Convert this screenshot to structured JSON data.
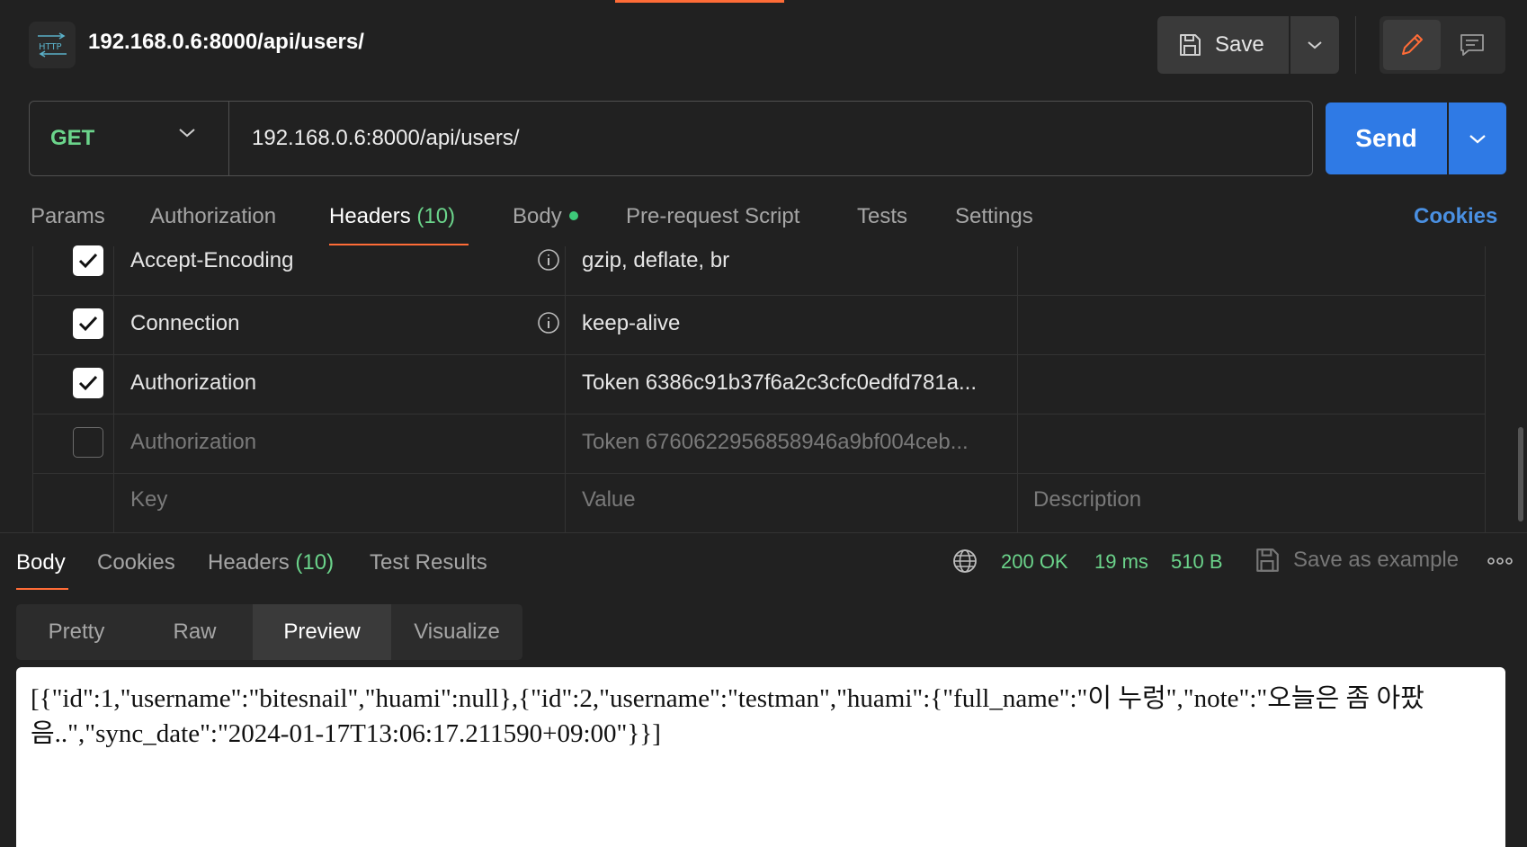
{
  "header": {
    "protocol_badge": "HTTP",
    "title": "192.168.0.6:8000/api/users/",
    "save_label": "Save"
  },
  "request": {
    "method": "GET",
    "url": "192.168.0.6:8000/api/users/",
    "send_label": "Send"
  },
  "request_tabs": {
    "params": "Params",
    "authorization": "Authorization",
    "headers": "Headers",
    "headers_count": "(10)",
    "body": "Body",
    "prerequest": "Pre-request Script",
    "tests": "Tests",
    "settings": "Settings",
    "cookies": "Cookies"
  },
  "headers_table": {
    "rows": [
      {
        "checked": true,
        "key": "Accept-Encoding",
        "value": "gzip, deflate, br",
        "info": true
      },
      {
        "checked": true,
        "key": "Connection",
        "value": "keep-alive",
        "info": true
      },
      {
        "checked": true,
        "key": "Authorization",
        "value": "Token 6386c91b37f6a2c3cfc0edfd781a...",
        "info": false
      },
      {
        "checked": false,
        "key": "Authorization",
        "value": "Token 6760622956858946a9bf004ceb...",
        "info": false
      }
    ],
    "placeholder_key": "Key",
    "placeholder_value": "Value",
    "placeholder_description": "Description"
  },
  "response_tabs": {
    "body": "Body",
    "cookies": "Cookies",
    "headers": "Headers",
    "headers_count": "(10)",
    "test_results": "Test Results"
  },
  "response_status": {
    "status": "200 OK",
    "time": "19 ms",
    "size": "510 B",
    "save_example": "Save as example"
  },
  "view_tabs": {
    "pretty": "Pretty",
    "raw": "Raw",
    "preview": "Preview",
    "visualize": "Visualize"
  },
  "preview_body": "[{\"id\":1,\"username\":\"bitesnail\",\"huami\":null},{\"id\":2,\"username\":\"testman\",\"huami\":{\"full_name\":\"이 누렁\",\"note\":\"오늘은 좀 아팠음..\",\"sync_date\":\"2024-01-17T13:06:17.211590+09:00\"}}]",
  "colors": {
    "accent_orange": "#ff6c37",
    "send_blue": "#2f7ae5",
    "status_green": "#6bd48b",
    "cookies_blue": "#4a90e2"
  }
}
